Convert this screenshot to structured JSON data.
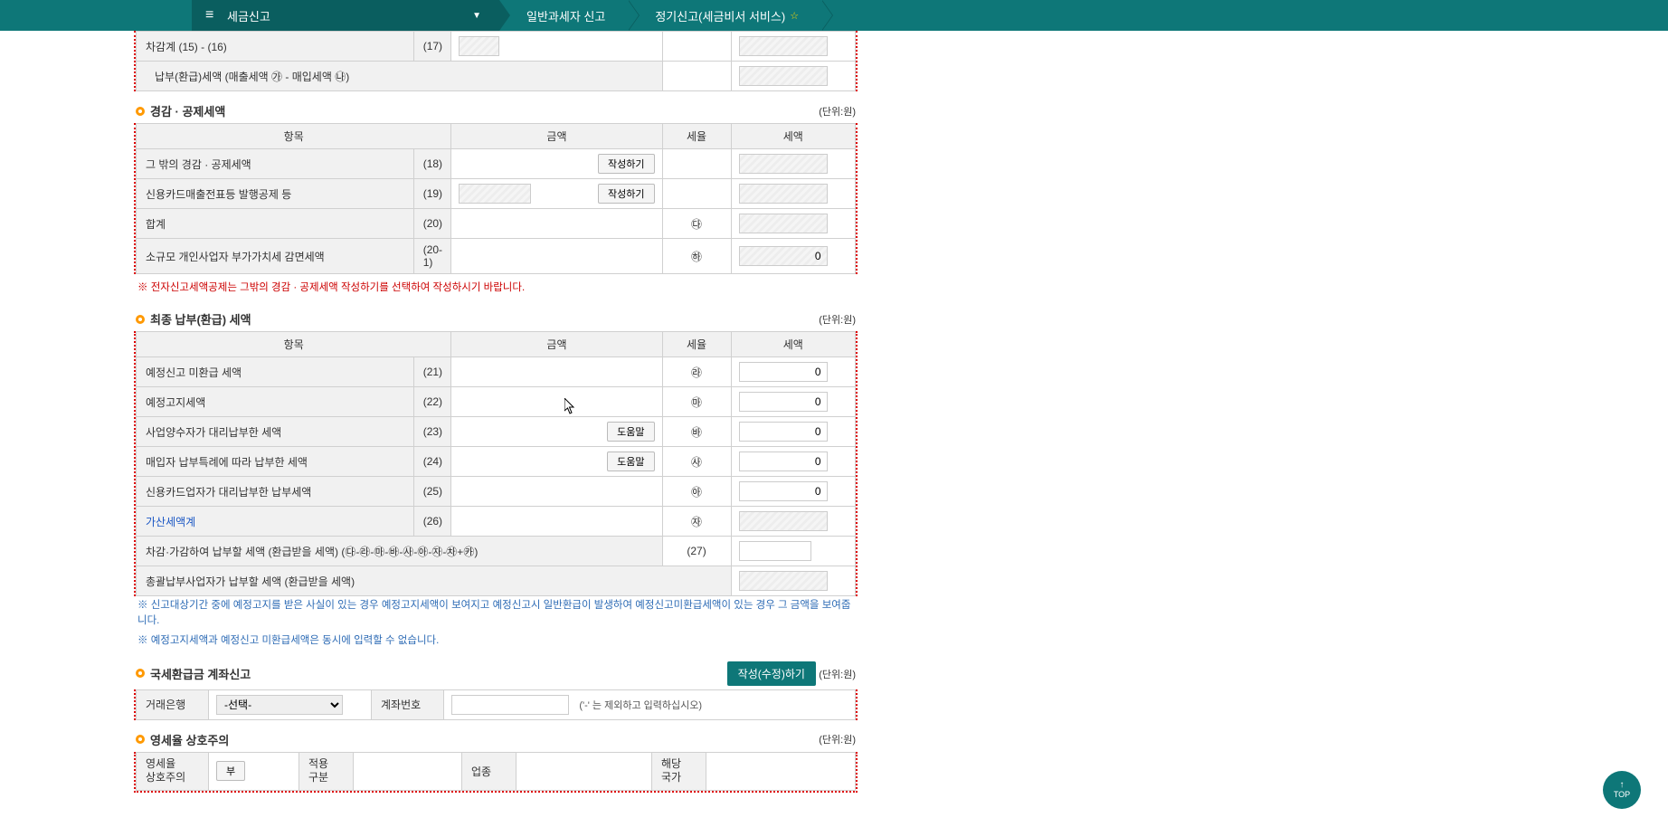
{
  "nav": {
    "main": "세금신고",
    "crumb1": "일반과세자 신고",
    "crumb2": "정기신고(세금비서 서비스)"
  },
  "unit": "(단위:원)",
  "partial_top": {
    "row1_label": "차감계 (15) - (16)",
    "row1_code": "(17)",
    "row2_label": "납부(환급)세액 (매출세액 ㉮ - 매입세액 ㉯)"
  },
  "section1": {
    "title": "경감 · 공제세액",
    "headers": {
      "item": "항목",
      "amount": "금액",
      "rate": "세율",
      "tax": "세액"
    },
    "rows": [
      {
        "label": "그 밖의 경감 · 공제세액",
        "code": "(18)",
        "btn": "작성하기"
      },
      {
        "label": "신용카드매출전표등 발행공제 등",
        "code": "(19)",
        "btn": "작성하기"
      },
      {
        "label": "합계",
        "code": "(20)",
        "sym": "㉰"
      },
      {
        "label": "소규모 개인사업자 부가가치세 감면세액",
        "code": "(20-1)",
        "sym": "㉻",
        "val": "0"
      }
    ],
    "note": "※ 전자신고세액공제는 그밖의 경감 · 공제세액 작성하기를 선택하여 작성하시기 바랍니다."
  },
  "section2": {
    "title": "최종 납부(환급) 세액",
    "headers": {
      "item": "항목",
      "amount": "금액",
      "rate": "세율",
      "tax": "세액"
    },
    "rows": [
      {
        "label": "예정신고 미환급 세액",
        "code": "(21)",
        "sym": "㉱",
        "val": "0"
      },
      {
        "label": "예정고지세액",
        "code": "(22)",
        "sym": "㉲",
        "val": "0"
      },
      {
        "label": "사업양수자가 대리납부한 세액",
        "code": "(23)",
        "sym": "㉳",
        "val": "0",
        "help": "도움말"
      },
      {
        "label": "매입자 납부특례에 따라 납부한 세액",
        "code": "(24)",
        "sym": "㉴",
        "val": "0",
        "help": "도움말"
      },
      {
        "label": "신용카드업자가 대리납부한 납부세액",
        "code": "(25)",
        "sym": "㉵",
        "val": "0"
      },
      {
        "label": "가산세액계",
        "code": "(26)",
        "sym": "㉶",
        "link": true
      },
      {
        "label": "차감·가감하여 납부할 세액 (환급받을 세액) (㉰-㉱-㉲-㉳-㉴-㉵-㉶-㉷+㉸)",
        "code": "(27)",
        "full": true
      },
      {
        "label": "총괄납부사업자가 납부할 세액 (환급받을 세액)",
        "full2": true
      }
    ],
    "note1": "※ 신고대상기간 중에 예정고지를 받은 사실이 있는 경우 예정고지세액이 보여지고 예정신고시 일반환급이 발생하여 예정신고미환급세액이 있는 경우 그 금액을 보여줍니다.",
    "note2": "※ 예정고지세액과 예정신고 미환급세액은 동시에 입력할 수 없습니다."
  },
  "section3": {
    "title": "국세환급금 계좌신고",
    "btn": "작성(수정)하기",
    "bank_label": "거래은행",
    "bank_placeholder": "-선택-",
    "account_label": "계좌번호",
    "hint": "('-' 는 제외하고 입력하십시오)"
  },
  "section4": {
    "title": "영세율 상호주의",
    "labels": {
      "a": "영세율\n상호주의",
      "a_val": "부",
      "b": "적용\n구분",
      "c": "업종",
      "d": "해당\n국가"
    }
  },
  "top_btn": "TOP"
}
